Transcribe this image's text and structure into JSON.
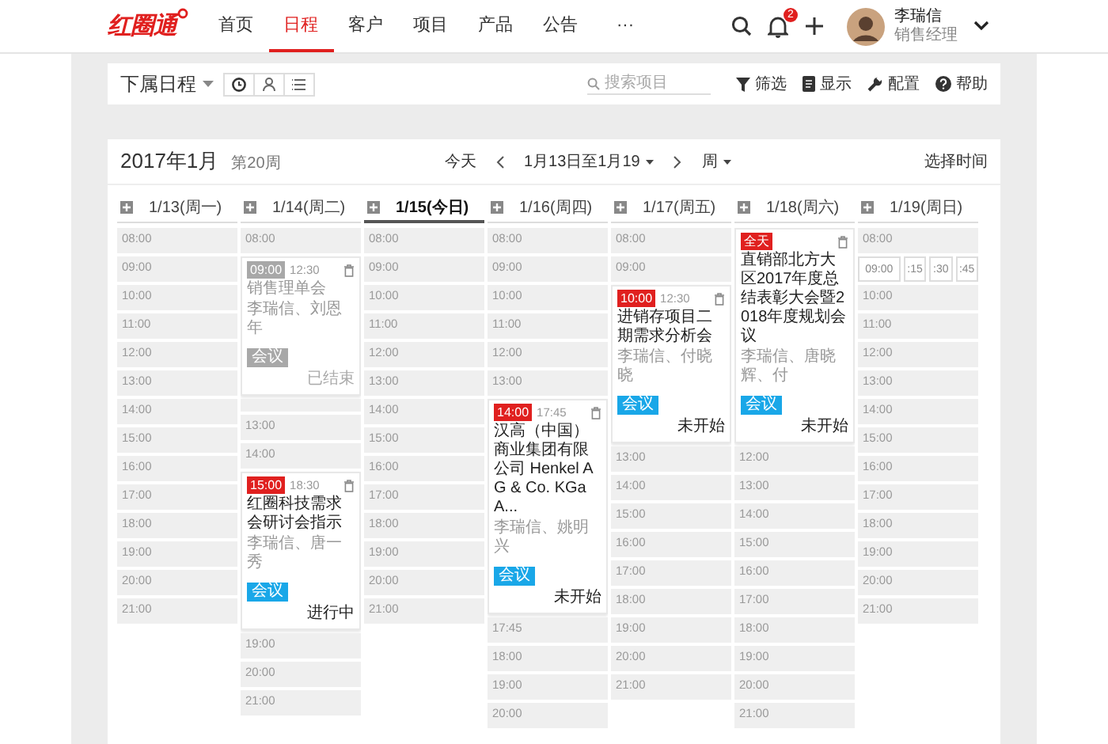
{
  "logo": {
    "text": "红圈通"
  },
  "nav": [
    {
      "label": "首页",
      "selected": false
    },
    {
      "label": "日程",
      "selected": true
    },
    {
      "label": "客户",
      "selected": false
    },
    {
      "label": "项目",
      "selected": false
    },
    {
      "label": "产品",
      "selected": false
    },
    {
      "label": "公告",
      "selected": false
    },
    {
      "label": "···",
      "selected": false
    }
  ],
  "notifications": {
    "count": "2"
  },
  "user": {
    "name": "李瑞信",
    "role": "销售经理"
  },
  "toolbar": {
    "title": "下属日程",
    "search": {
      "placeholder": "搜索项目"
    },
    "actions": [
      {
        "kind": "filter",
        "label": "筛选"
      },
      {
        "kind": "display",
        "label": "显示"
      },
      {
        "kind": "config",
        "label": "配置"
      },
      {
        "kind": "help",
        "label": "帮助"
      }
    ]
  },
  "calendar": {
    "month": "2017年1月",
    "week": "第20周",
    "today": "今天",
    "range": "1月13日至1月19",
    "view": "周",
    "pick_time": "选择时间",
    "days": [
      {
        "label": "1/13(周一)",
        "selected": false,
        "items": [
          {
            "kind": "slot",
            "time": "08:00"
          },
          {
            "kind": "slot",
            "time": "09:00"
          },
          {
            "kind": "slot",
            "time": "10:00"
          },
          {
            "kind": "slot",
            "time": "11:00"
          },
          {
            "kind": "slot",
            "time": "12:00"
          },
          {
            "kind": "slot",
            "time": "13:00"
          },
          {
            "kind": "slot",
            "time": "14:00"
          },
          {
            "kind": "slot",
            "time": "15:00"
          },
          {
            "kind": "slot",
            "time": "16:00"
          },
          {
            "kind": "slot",
            "time": "17:00"
          },
          {
            "kind": "slot",
            "time": "18:00"
          },
          {
            "kind": "slot",
            "time": "19:00"
          },
          {
            "kind": "slot",
            "time": "20:00"
          },
          {
            "kind": "slot",
            "time": "21:00"
          }
        ]
      },
      {
        "label": "1/14(周二)",
        "selected": false,
        "items": [
          {
            "kind": "slot",
            "time": "08:00"
          },
          {
            "kind": "event",
            "start": "09:00",
            "end": "12:30",
            "title": "销售理单会",
            "people": "李瑞信、刘恩年",
            "tag": "会议",
            "status": "已结束",
            "ended": true
          },
          {
            "kind": "slot"
          },
          {
            "kind": "slot",
            "time": "13:00"
          },
          {
            "kind": "slot",
            "time": "14:00"
          },
          {
            "kind": "event",
            "start": "15:00",
            "end": "18:30",
            "title": "红圈科技需求会研讨会指示",
            "people": "李瑞信、唐一秀",
            "tag": "会议",
            "status": "进行中",
            "ended": false
          },
          {
            "kind": "slot",
            "time": "19:00"
          },
          {
            "kind": "slot",
            "time": "20:00"
          },
          {
            "kind": "slot",
            "time": "21:00"
          }
        ]
      },
      {
        "label": "1/15(今日)",
        "selected": true,
        "items": [
          {
            "kind": "slot",
            "time": "08:00"
          },
          {
            "kind": "slot",
            "time": "09:00"
          },
          {
            "kind": "slot",
            "time": "10:00"
          },
          {
            "kind": "slot",
            "time": "11:00"
          },
          {
            "kind": "slot",
            "time": "12:00"
          },
          {
            "kind": "slot",
            "time": "13:00"
          },
          {
            "kind": "slot",
            "time": "14:00"
          },
          {
            "kind": "slot",
            "time": "15:00"
          },
          {
            "kind": "slot",
            "time": "16:00"
          },
          {
            "kind": "slot",
            "time": "17:00"
          },
          {
            "kind": "slot",
            "time": "18:00"
          },
          {
            "kind": "slot",
            "time": "19:00"
          },
          {
            "kind": "slot",
            "time": "20:00"
          },
          {
            "kind": "slot",
            "time": "21:00"
          }
        ]
      },
      {
        "label": "1/16(周四)",
        "selected": false,
        "items": [
          {
            "kind": "slot",
            "time": "08:00"
          },
          {
            "kind": "slot",
            "time": "09:00"
          },
          {
            "kind": "slot",
            "time": "10:00"
          },
          {
            "kind": "slot",
            "time": "11:00"
          },
          {
            "kind": "slot",
            "time": "12:00"
          },
          {
            "kind": "slot",
            "time": "13:00"
          },
          {
            "kind": "event",
            "start": "14:00",
            "end": "17:45",
            "title": "汉高（中国）商业集团有限公司 Henkel AG & Co. KGaA...",
            "people": "李瑞信、姚明兴",
            "tag": "会议",
            "status": "未开始",
            "ended": false
          },
          {
            "kind": "slot",
            "time": "17:45"
          },
          {
            "kind": "slot",
            "time": "18:00"
          },
          {
            "kind": "slot",
            "time": "19:00"
          },
          {
            "kind": "slot",
            "time": "20:00"
          }
        ]
      },
      {
        "label": "1/17(周五)",
        "selected": false,
        "items": [
          {
            "kind": "slot",
            "time": "08:00"
          },
          {
            "kind": "slot",
            "time": "09:00"
          },
          {
            "kind": "event",
            "start": "10:00",
            "end": "12:30",
            "title": "进销存项目二期需求分析会",
            "people": "李瑞信、付晓晓",
            "tag": "会议",
            "status": "未开始",
            "ended": false
          },
          {
            "kind": "slot",
            "time": "13:00"
          },
          {
            "kind": "slot",
            "time": "14:00"
          },
          {
            "kind": "slot",
            "time": "15:00"
          },
          {
            "kind": "slot",
            "time": "16:00"
          },
          {
            "kind": "slot",
            "time": "17:00"
          },
          {
            "kind": "slot",
            "time": "18:00"
          },
          {
            "kind": "slot",
            "time": "19:00"
          },
          {
            "kind": "slot",
            "time": "20:00"
          },
          {
            "kind": "slot",
            "time": "21:00"
          }
        ]
      },
      {
        "label": "1/18(周六)",
        "selected": false,
        "items": [
          {
            "kind": "event",
            "start": "全天",
            "title": "直销部北方大区2017年度总结表彰大会暨2018年度规划会议",
            "people": "李瑞信、唐晓辉、付",
            "tag": "会议",
            "status": "未开始",
            "ended": false
          },
          {
            "kind": "slot",
            "time": "12:00"
          },
          {
            "kind": "slot",
            "time": "13:00"
          },
          {
            "kind": "slot",
            "time": "14:00"
          },
          {
            "kind": "slot",
            "time": "15:00"
          },
          {
            "kind": "slot",
            "time": "16:00"
          },
          {
            "kind": "slot",
            "time": "17:00"
          },
          {
            "kind": "slot",
            "time": "18:00"
          },
          {
            "kind": "slot",
            "time": "19:00"
          },
          {
            "kind": "slot",
            "time": "20:00"
          },
          {
            "kind": "slot",
            "time": "21:00"
          }
        ]
      },
      {
        "label": "1/19(周日)",
        "selected": false,
        "items": [
          {
            "kind": "slot",
            "time": "08:00"
          },
          {
            "kind": "picker",
            "options": [
              "09:00",
              ":15",
              ":30",
              ":45"
            ]
          },
          {
            "kind": "slot",
            "time": "10:00"
          },
          {
            "kind": "slot",
            "time": "11:00"
          },
          {
            "kind": "slot",
            "time": "12:00"
          },
          {
            "kind": "slot",
            "time": "13:00"
          },
          {
            "kind": "slot",
            "time": "14:00"
          },
          {
            "kind": "slot",
            "time": "15:00"
          },
          {
            "kind": "slot",
            "time": "16:00"
          },
          {
            "kind": "slot",
            "time": "17:00"
          },
          {
            "kind": "slot",
            "time": "18:00"
          },
          {
            "kind": "slot",
            "time": "19:00"
          },
          {
            "kind": "slot",
            "time": "20:00"
          },
          {
            "kind": "slot",
            "time": "21:00"
          }
        ]
      }
    ]
  }
}
